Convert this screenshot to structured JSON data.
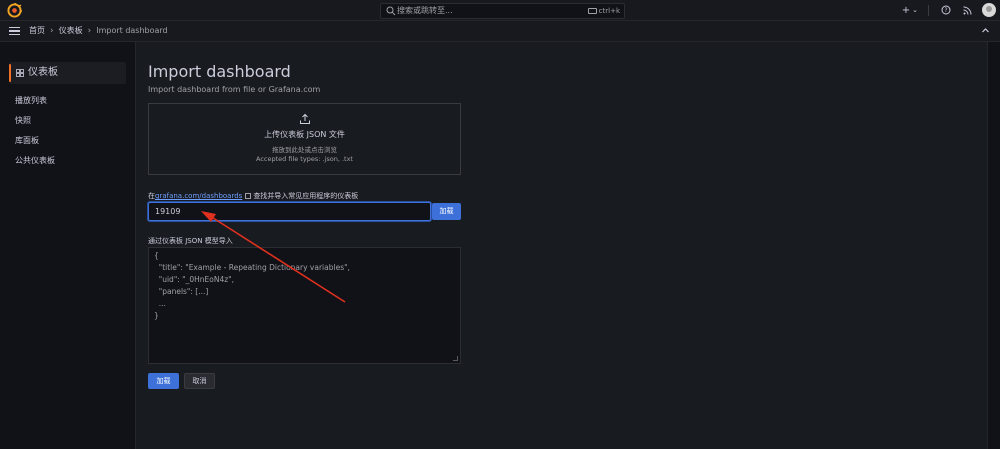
{
  "topbar": {
    "search_placeholder": "搜索或跳转至...",
    "search_shortcut": "ctrl+k",
    "add_label": "+",
    "add_caret": "⌄",
    "help_icon": "help-icon",
    "rss_icon": "rss-icon"
  },
  "breadcrumb": {
    "items": [
      "首页",
      "仪表板",
      "Import dashboard"
    ],
    "separator": "›"
  },
  "sidebar": {
    "title": "仪表板",
    "items": [
      "播放列表",
      "快照",
      "库面板",
      "公共仪表板"
    ]
  },
  "page": {
    "title": "Import dashboard",
    "subtitle": "Import dashboard from file or Grafana.com"
  },
  "upload": {
    "title": "上传仪表板 JSON 文件",
    "hint": "拖放到此处或点击浏览",
    "accepted": "Accepted file types: .json, .txt"
  },
  "grafana_com": {
    "prefix": "在",
    "link_text": "grafana.com/dashboards",
    "suffix": "查找并导入常见应用程序的仪表板",
    "input_value": "19109",
    "load_label": "加载"
  },
  "json_model": {
    "label": "通过仪表板 JSON 模型导入",
    "placeholder_lines": [
      "{",
      "  \"title\": \"Example - Repeating Dictionary variables\",",
      "  \"uid\": \"_0HnEoN4z\",",
      "  \"panels\": [...]",
      "  ...",
      "}"
    ]
  },
  "actions": {
    "load_label": "加载",
    "cancel_label": "取消"
  },
  "colors": {
    "primary": "#3d71d9",
    "accent_orange": "#f56f26",
    "annotation_arrow": "#e0301e"
  }
}
